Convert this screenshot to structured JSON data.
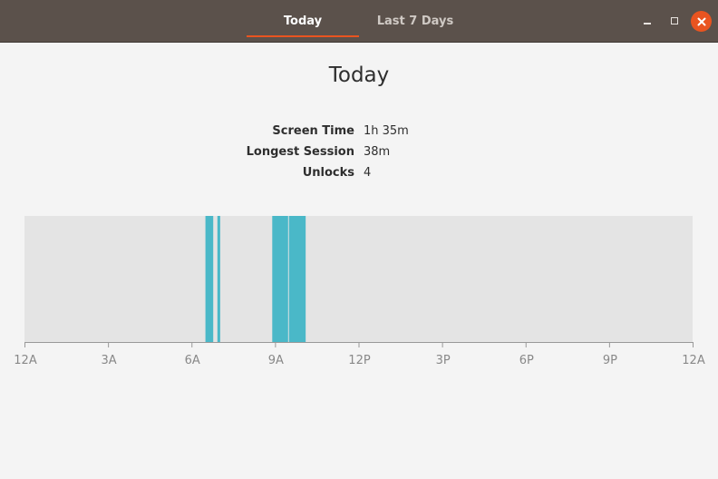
{
  "tabs": [
    {
      "label": "Today",
      "active": true
    },
    {
      "label": "Last 7 Days",
      "active": false
    }
  ],
  "window_controls": {
    "minimize": "minimize-icon",
    "maximize": "maximize-icon",
    "close": "close-icon",
    "close_color": "#e95420"
  },
  "page": {
    "title": "Today"
  },
  "stats": [
    {
      "label": "Screen Time",
      "value": "1h 35m"
    },
    {
      "label": "Longest Session",
      "value": "38m"
    },
    {
      "label": "Unlocks",
      "value": "4"
    }
  ],
  "chart_data": {
    "type": "bar",
    "x_unit": "hour of day",
    "xlim": [
      0,
      24
    ],
    "tick_labels": [
      "12A",
      "3A",
      "6A",
      "9A",
      "12P",
      "3P",
      "6P",
      "9P",
      "12A"
    ],
    "sessions": [
      {
        "start": 6.5,
        "end": 6.78
      },
      {
        "start": 6.93,
        "end": 7.03
      },
      {
        "start": 8.9,
        "end": 9.47
      },
      {
        "start": 9.5,
        "end": 10.1
      }
    ],
    "session_color": "#4ab8c8",
    "background_color": "#e4e4e4"
  }
}
